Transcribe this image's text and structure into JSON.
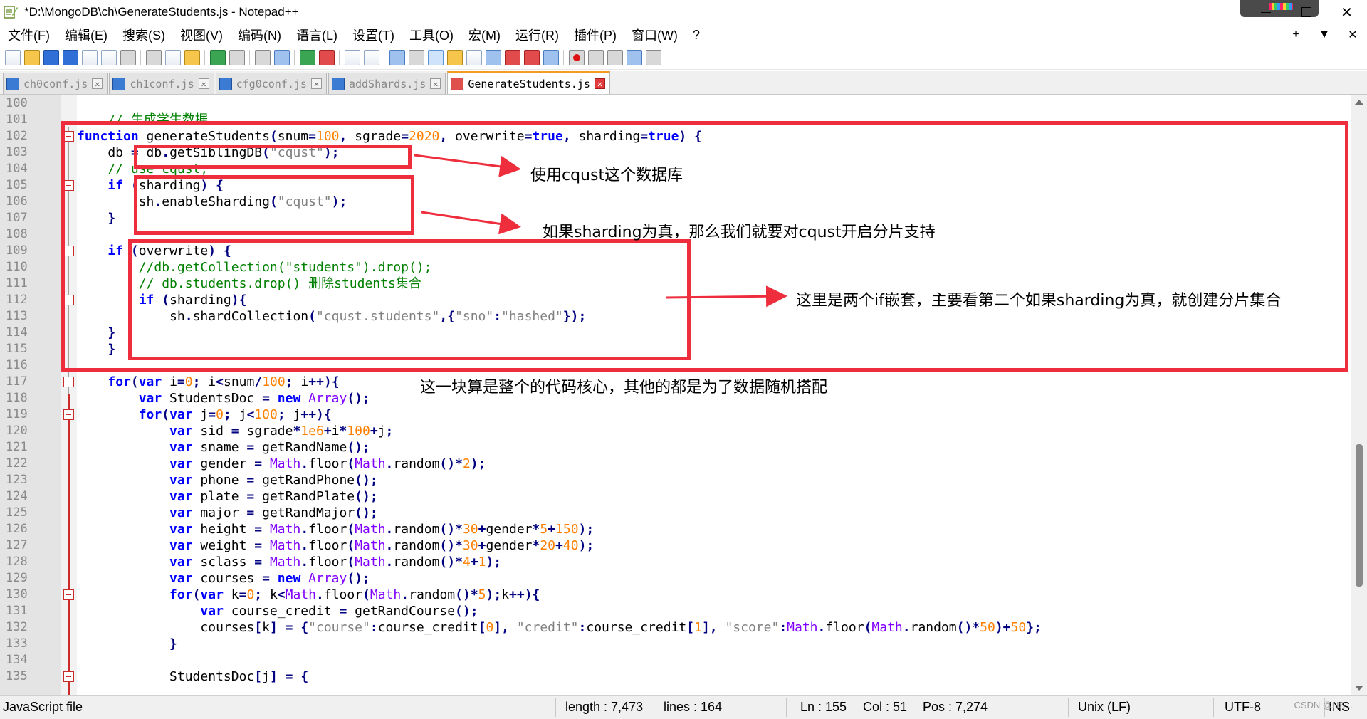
{
  "window": {
    "title": "*D:\\MongoDB\\ch\\GenerateStudents.js - Notepad++",
    "close_glyph": "✕"
  },
  "menu": [
    "文件(F)",
    "编辑(E)",
    "搜索(S)",
    "视图(V)",
    "编码(N)",
    "语言(L)",
    "设置(T)",
    "工具(O)",
    "宏(M)",
    "运行(R)",
    "插件(P)",
    "窗口(W)",
    "?"
  ],
  "menu_right": {
    "plus": "+",
    "down": "▼",
    "close": "✕"
  },
  "tabs": [
    {
      "label": "ch0conf.js",
      "active": false
    },
    {
      "label": "ch1conf.js",
      "active": false
    },
    {
      "label": "cfg0conf.js",
      "active": false
    },
    {
      "label": "addShards.js",
      "active": false
    },
    {
      "label": "GenerateStudents.js",
      "active": true
    }
  ],
  "tab_close_glyph": "✕",
  "editor": {
    "line_numbers": [
      "100",
      "101",
      "102",
      "103",
      "104",
      "105",
      "106",
      "107",
      "108",
      "109",
      "110",
      "111",
      "112",
      "113",
      "114",
      "115",
      "116",
      "117",
      "118",
      "119",
      "120",
      "121",
      "122",
      "123",
      "124",
      "125",
      "126",
      "127",
      "128",
      "129",
      "130",
      "131",
      "132",
      "133",
      "134",
      "135"
    ],
    "fold_lines": [
      "102",
      "105",
      "109",
      "112",
      "117",
      "119",
      "130",
      "135"
    ]
  },
  "annotations": {
    "note_db": "使用cqust这个数据库",
    "note_sharding": "如果sharding为真，那么我们就要对cqust开启分片支持",
    "note_nested_if": "这里是两个if嵌套，主要看第二个如果sharding为真，就创建分片集合",
    "note_core": "这一块算是整个的代码核心，其他的都是为了数据随机搭配",
    "color": "#ee2e3c"
  },
  "status": {
    "file_type": "JavaScript file",
    "length": "length : 7,473",
    "lines": "lines : 164",
    "ln": "Ln : 155",
    "col": "Col : 51",
    "pos": "Pos : 7,274",
    "eol": "Unix (LF)",
    "encoding": "UTF-8",
    "mode": "INS",
    "watermark": "CSDN @HS..."
  },
  "icons": [
    "notepad-icon",
    "new-file-icon",
    "open-folder-icon",
    "save-icon",
    "save-all-icon",
    "close-icon",
    "close-all-icon",
    "print-icon",
    "cut-icon",
    "copy-icon",
    "paste-icon",
    "undo-icon",
    "redo-icon",
    "find-icon",
    "replace-icon",
    "zoom-in-icon",
    "zoom-out-icon",
    "sync-vertical-icon",
    "sync-horizontal-icon",
    "word-wrap-icon",
    "show-all-chars-icon",
    "indent-guide-icon",
    "udl-icon",
    "doc-map-icon",
    "function-list-icon",
    "folder-workspace-icon",
    "monitor-icon",
    "record-macro-icon",
    "stop-macro-icon",
    "play-macro-icon",
    "run-macro-multiple-icon",
    "save-macro-icon"
  ]
}
